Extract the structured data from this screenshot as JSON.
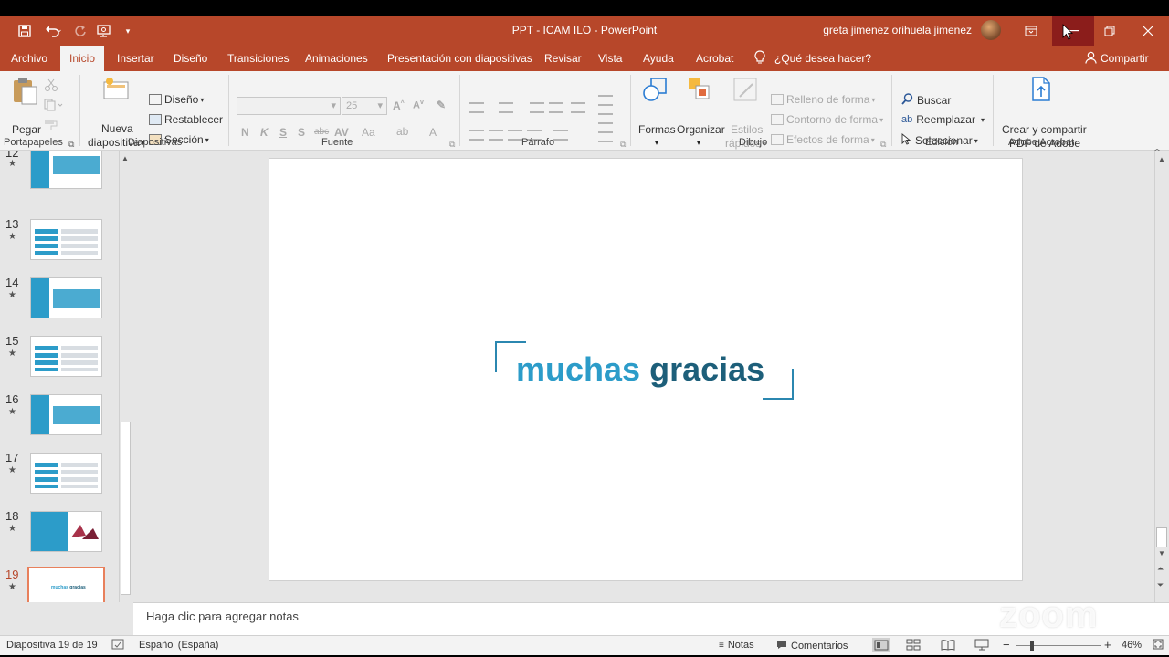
{
  "window": {
    "title": "PPT - ICAM ILO  -  PowerPoint",
    "user_name": "greta jimenez orihuela jimenez"
  },
  "tabs": [
    {
      "label": "Archivo"
    },
    {
      "label": "Inicio"
    },
    {
      "label": "Insertar"
    },
    {
      "label": "Diseño"
    },
    {
      "label": "Transiciones"
    },
    {
      "label": "Animaciones"
    },
    {
      "label": "Presentación con diapositivas"
    },
    {
      "label": "Revisar"
    },
    {
      "label": "Vista"
    },
    {
      "label": "Ayuda"
    },
    {
      "label": "Acrobat"
    }
  ],
  "tell_me": "¿Qué desea hacer?",
  "share": "Compartir",
  "ribbon": {
    "clipboard": {
      "paste": "Pegar",
      "label": "Portapapeles"
    },
    "slides": {
      "new_slide_line1": "Nueva",
      "new_slide_line2": "diapositiva",
      "layout": "Diseño",
      "reset": "Restablecer",
      "section": "Sección",
      "label": "Diapositivas"
    },
    "font": {
      "size": "25",
      "bold": "N",
      "italic": "K",
      "underline": "S",
      "shadow": "S",
      "strike": "abc",
      "label": "Fuente"
    },
    "paragraph": {
      "label": "Párrafo"
    },
    "drawing": {
      "shapes": "Formas",
      "arrange": "Organizar",
      "quick_styles_line1": "Estilos",
      "quick_styles_line2": "rápidos",
      "fill": "Relleno de forma",
      "outline": "Contorno de forma",
      "effects": "Efectos de forma",
      "label": "Dibujo"
    },
    "editing": {
      "find": "Buscar",
      "replace": "Reemplazar",
      "select": "Seleccionar",
      "label": "Edición"
    },
    "acrobat": {
      "create_line1": "Crear y compartir",
      "create_line2": "PDF de Adobe",
      "label": "Adobe Acrobat"
    }
  },
  "thumbnails": [
    {
      "num": "12"
    },
    {
      "num": "13"
    },
    {
      "num": "14"
    },
    {
      "num": "15"
    },
    {
      "num": "16"
    },
    {
      "num": "17"
    },
    {
      "num": "18"
    },
    {
      "num": "19"
    }
  ],
  "slide": {
    "word1": "muchas",
    "word2": "gracias"
  },
  "notes_placeholder": "Haga clic para agregar notas",
  "watermark": "zoom",
  "status": {
    "slide_info": "Diapositiva 19 de 19",
    "language": "Español (España)",
    "notes": "Notas",
    "comments": "Comentarios",
    "zoom_level": "46%"
  },
  "colors": {
    "accent": "#b7472a",
    "slide_blue_light": "#2c9cc9",
    "slide_blue_dark": "#1d5f7a"
  }
}
